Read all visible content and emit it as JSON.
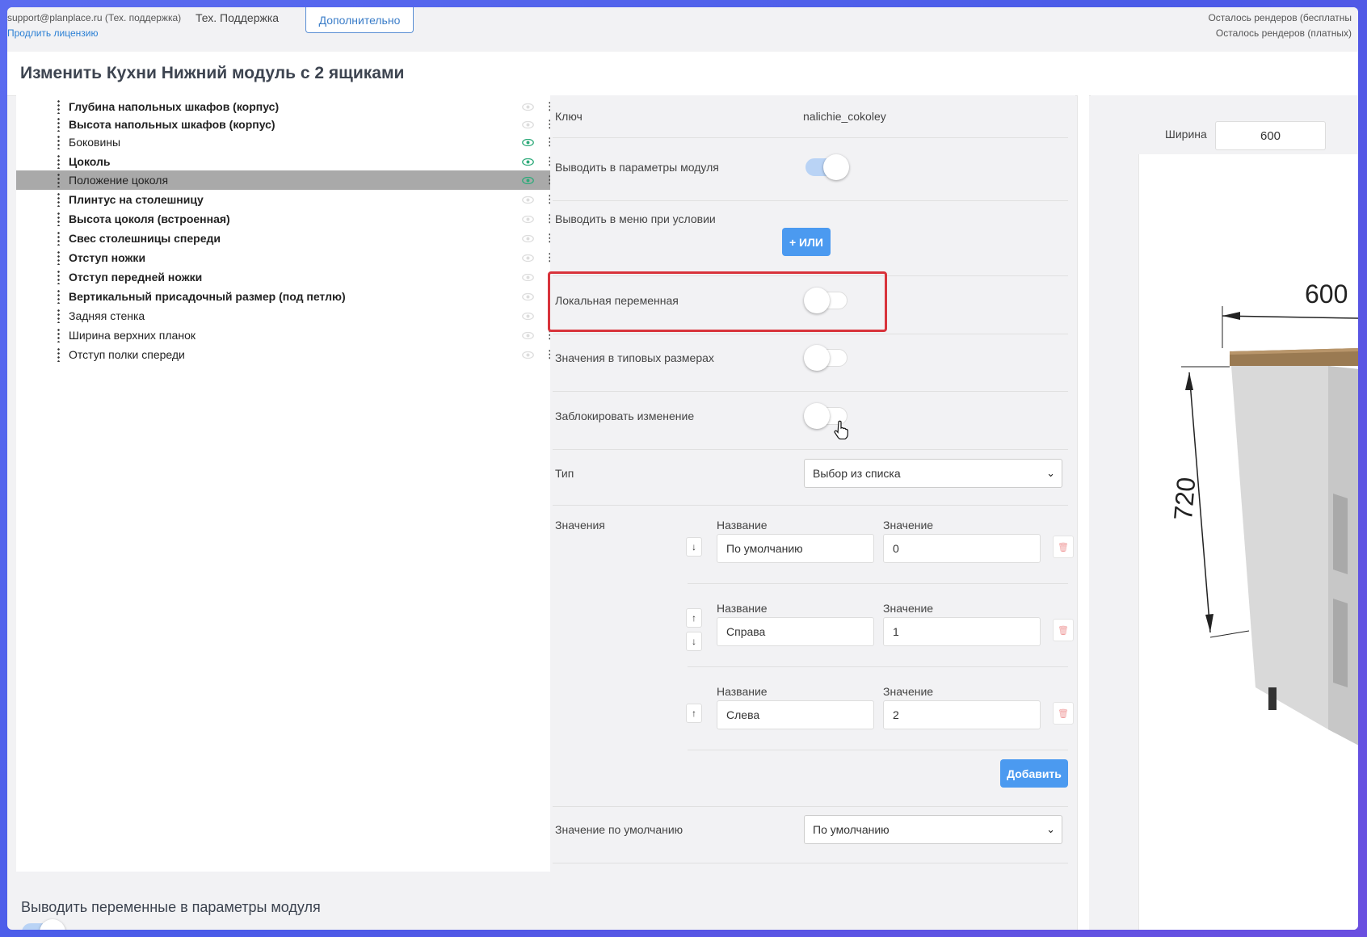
{
  "header": {
    "email": "support@planplace.ru (Тех. поддержка)",
    "renew_link": "Продлить лицензию",
    "support": "Тех. Поддержка",
    "more_button": "Дополнительно",
    "renders_free": "Осталось рендеров (бесплатны",
    "renders_paid": "Осталось рендеров (платных)"
  },
  "page": {
    "title": "Изменить Кухни Нижний модуль с 2 ящиками"
  },
  "tree": {
    "items": [
      {
        "label": "Глубина напольных шкафов (корпус)"
      },
      {
        "label": "Высота напольных шкафов (корпус)"
      },
      {
        "label": "Боковины"
      },
      {
        "label": "Цоколь"
      },
      {
        "label": "Положение цоколя"
      },
      {
        "label": "Плинтус на столешницу"
      },
      {
        "label": "Высота цоколя (встроенная)"
      },
      {
        "label": "Свес столешницы спереди"
      },
      {
        "label": "Отступ ножки"
      },
      {
        "label": "Отступ передней ножки"
      },
      {
        "label": "Вертикальный присадочный размер (под петлю)"
      },
      {
        "label": "Задняя стенка"
      },
      {
        "label": "Ширина верхних планок"
      },
      {
        "label": "Отступ полки спереди"
      }
    ],
    "kebab": "⋮"
  },
  "form": {
    "key_label": "Ключ",
    "key_value": "nalichie_cokoley",
    "show_in_params_label": "Выводить в параметры модуля",
    "show_in_menu_label": "Выводить в меню при условии",
    "or_button": "+ ИЛИ",
    "local_var_label": "Локальная переменная",
    "typical_sizes_label": "Значения в типовых размерах",
    "lock_label": "Заблокировать изменение",
    "type_label": "Тип",
    "type_value": "Выбор из списка",
    "values_label": "Значения",
    "name_header": "Название",
    "value_header": "Значение",
    "rows": [
      {
        "name": "По умолчанию",
        "value": "0"
      },
      {
        "name": "Справа",
        "value": "1"
      },
      {
        "name": "Слева",
        "value": "2"
      }
    ],
    "arrow_down": "↓",
    "arrow_up": "↑",
    "add_button": "Добавить",
    "default_label": "Значение по умолчанию",
    "default_value": "По умолчанию"
  },
  "bottom": {
    "title": "Выводить переменные в параметры модуля"
  },
  "preview": {
    "width_label": "Ширина",
    "width_value": "600",
    "dim_width": "600",
    "dim_height": "720"
  }
}
